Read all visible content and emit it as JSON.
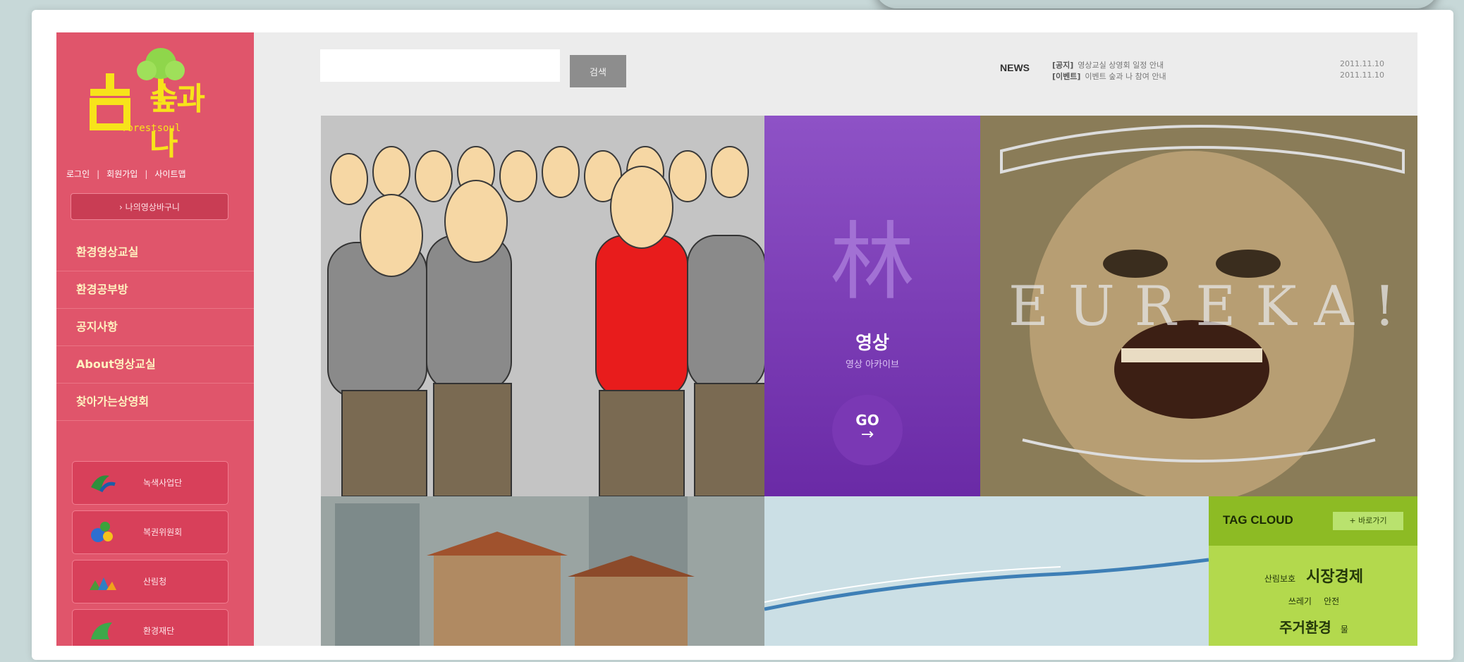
{
  "logo": {
    "text": "숲과나",
    "subtext": "forestsoul"
  },
  "util_links": [
    "로그인",
    "회원가입",
    "사이트맵"
  ],
  "basket_label": "› 나의영상바구니",
  "nav": [
    "환경영상교실",
    "환경공부방",
    "공지사항",
    "About영상교실",
    "찾아가는상영회"
  ],
  "partners": [
    "녹색사업단",
    "복권위원회",
    "산림청",
    "환경재단"
  ],
  "search": {
    "placeholder": "",
    "button": "검색"
  },
  "news": {
    "label": "NEWS",
    "items": [
      {
        "tag": "[공지]",
        "text": "영상교실 상영회 일정 안내",
        "date": "2011.11.10"
      },
      {
        "tag": "[이벤트]",
        "text": "이벤트 숲과 나 참여 안내",
        "date": "2011.11.10"
      }
    ]
  },
  "purple_tile": {
    "char": "林",
    "title": "영상",
    "subtitle": "영상 아카이브",
    "go": "GO",
    "arrow": "→"
  },
  "eureka_text": "EUREKA!",
  "tag_cloud": {
    "title": "TAG CLOUD",
    "more": "+ 바로가기",
    "rows": [
      {
        "small": "산림보호",
        "big": "시장경제"
      },
      {
        "small": "쓰레기",
        "small2": "안전"
      },
      {
        "big": "주거환경",
        "small": "물"
      }
    ]
  },
  "colors": {
    "sidebar": "#e0556b",
    "nav_text": "#fff2c0",
    "purple": "#7a38b4",
    "tag_green": "#b3d94d"
  }
}
